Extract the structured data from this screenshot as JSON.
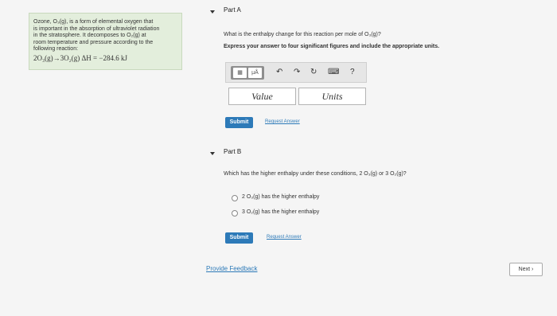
{
  "info": {
    "lines": [
      "Ozone, O₃(g), is a form of elemental oxygen that",
      "is important in the absorption of ultraviolet radiation",
      "in the stratosphere. It decomposes to O₂(g) at",
      "room temperature and pressure according to the",
      "following reaction:"
    ],
    "equation": "2O₃(g)→3O₂(g)   ΔH = −284.6 kJ"
  },
  "partA": {
    "title": "Part A",
    "question": "What is the enthalpy change for this reaction per mole of O₃(g)?",
    "instruction": "Express your answer to four significant figures and include the appropriate units.",
    "toolbar": {
      "templates_icon": "templates-icon",
      "mu": "μÅ",
      "undo": "↶",
      "redo": "↷",
      "reset": "↻",
      "keyboard": "⌨",
      "help": "?"
    },
    "value_placeholder": "Value",
    "units_placeholder": "Units",
    "submit": "Submit",
    "request": "Request Answer"
  },
  "partB": {
    "title": "Part B",
    "question": "Which has the higher enthalpy under these conditions, 2 O₃(g) or 3 O₂(g)?",
    "options": [
      "2 O₃(g) has the higher enthalpy",
      "3 O₂(g) has the higher enthalpy"
    ],
    "submit": "Submit",
    "request": "Request Answer"
  },
  "feedback": "Provide Feedback",
  "next": "Next ›"
}
